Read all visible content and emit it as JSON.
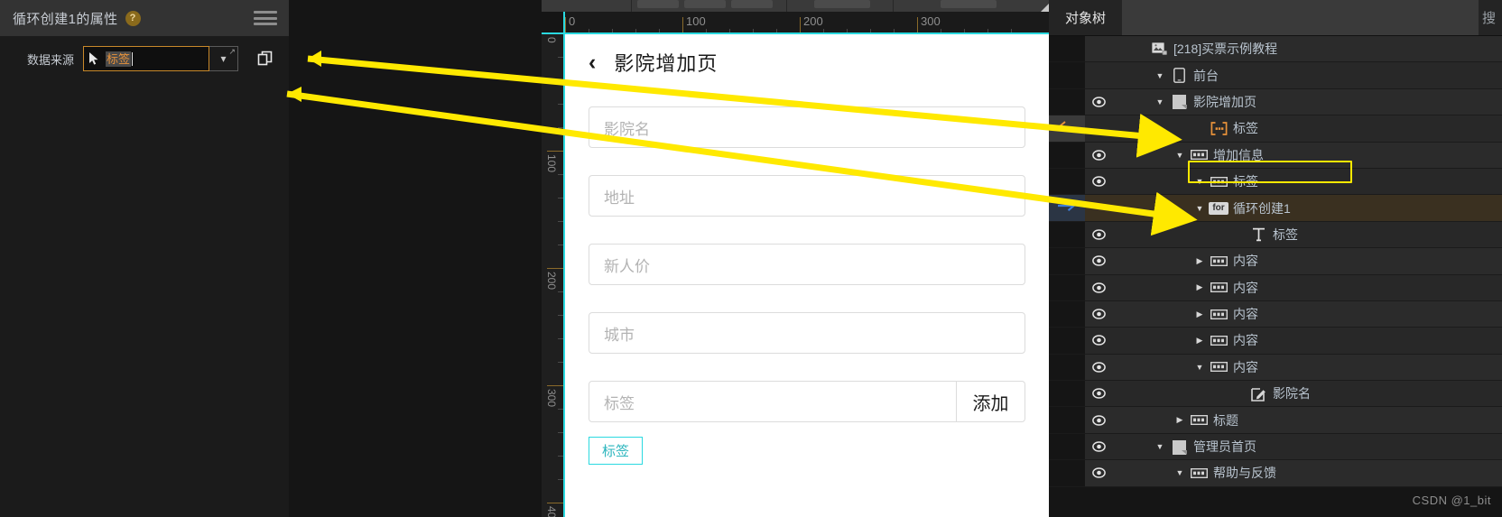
{
  "left_panel": {
    "title": "循环创建1的属性",
    "help_icon": "?",
    "menu_icon": "hamburger-icon",
    "data_source": {
      "label": "数据来源",
      "pointer_icon": "cursor-pointer-icon",
      "value": "标签",
      "dropdown_icon": "chevron-down-icon",
      "expand_icon": "expand-arrow-icon",
      "copy_icon": "duplicate-icon"
    }
  },
  "canvas": {
    "ruler_h": {
      "labels": [
        "0",
        "100",
        "200",
        "300"
      ]
    },
    "ruler_v": {
      "labels": [
        "0",
        "100",
        "200",
        "300",
        "40"
      ]
    },
    "artboard": {
      "back_icon": "chevron-left-icon",
      "title": "影院增加页",
      "fields": [
        {
          "placeholder": "影院名"
        },
        {
          "placeholder": "地址"
        },
        {
          "placeholder": "新人价"
        },
        {
          "placeholder": "城市"
        }
      ],
      "tag_field": {
        "placeholder": "标签"
      },
      "add_button": "添加",
      "tag_chip": "标签"
    }
  },
  "right_panel": {
    "tab": "对象树",
    "search_label": "搜",
    "watermark": "CSDN @1_bit",
    "tree": [
      {
        "label": "[218]买票示例教程",
        "indent": 1,
        "icon": "project-icon",
        "twisty": "",
        "eye": false,
        "selected": false,
        "marker": ""
      },
      {
        "label": "前台",
        "indent": 2,
        "icon": "phone-icon",
        "twisty": "down",
        "eye": false,
        "selected": false,
        "marker": ""
      },
      {
        "label": "影院增加页",
        "indent": 2,
        "icon": "page-icon",
        "twisty": "down",
        "eye": true,
        "selected": false,
        "marker": ""
      },
      {
        "label": "标签",
        "indent": 4,
        "icon": "repeater-icon",
        "twisty": "",
        "eye": false,
        "selected": false,
        "marker": "left-arrow"
      },
      {
        "label": "增加信息",
        "indent": 3,
        "icon": "box-icon",
        "twisty": "down",
        "eye": true,
        "selected": false,
        "marker": ""
      },
      {
        "label": "标签",
        "indent": 4,
        "icon": "box-icon",
        "twisty": "down",
        "eye": true,
        "selected": false,
        "marker": ""
      },
      {
        "label": "循环创建1",
        "indent": 4,
        "icon": "for-badge",
        "twisty": "down",
        "eye": false,
        "selected": true,
        "marker": "right-arrow"
      },
      {
        "label": "标签",
        "indent": 6,
        "icon": "text-icon",
        "twisty": "",
        "eye": true,
        "selected": false,
        "marker": ""
      },
      {
        "label": "内容",
        "indent": 4,
        "icon": "box-icon",
        "twisty": "right",
        "eye": true,
        "selected": false,
        "marker": ""
      },
      {
        "label": "内容",
        "indent": 4,
        "icon": "box-icon",
        "twisty": "right",
        "eye": true,
        "selected": false,
        "marker": ""
      },
      {
        "label": "内容",
        "indent": 4,
        "icon": "box-icon",
        "twisty": "right",
        "eye": true,
        "selected": false,
        "marker": ""
      },
      {
        "label": "内容",
        "indent": 4,
        "icon": "box-icon",
        "twisty": "right",
        "eye": true,
        "selected": false,
        "marker": ""
      },
      {
        "label": "内容",
        "indent": 4,
        "icon": "box-icon",
        "twisty": "down",
        "eye": true,
        "selected": false,
        "marker": ""
      },
      {
        "label": "影院名",
        "indent": 6,
        "icon": "input-icon",
        "twisty": "",
        "eye": true,
        "selected": false,
        "marker": ""
      },
      {
        "label": "标题",
        "indent": 3,
        "icon": "box-icon",
        "twisty": "right",
        "eye": true,
        "selected": false,
        "marker": ""
      },
      {
        "label": "管理员首页",
        "indent": 2,
        "icon": "page-icon",
        "twisty": "down",
        "eye": true,
        "selected": false,
        "marker": ""
      },
      {
        "label": "帮助与反馈",
        "indent": 3,
        "icon": "box-icon",
        "twisty": "down",
        "eye": true,
        "selected": false,
        "marker": ""
      }
    ]
  },
  "annotations": {
    "arrow_color": "#ffe900",
    "arrows": [
      {
        "name": "arrow-to-tag-node"
      },
      {
        "name": "arrow-to-loop-node"
      }
    ]
  }
}
